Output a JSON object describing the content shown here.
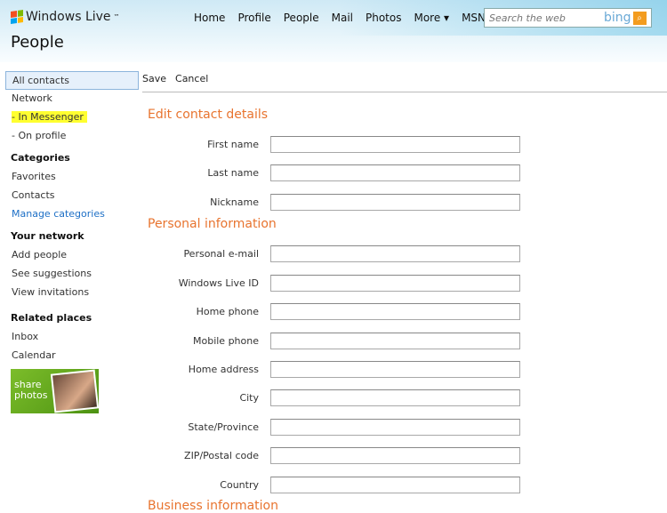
{
  "header": {
    "logo": "Windows Live",
    "logo_tm": "™",
    "title": "People",
    "nav": [
      "Home",
      "Profile",
      "People",
      "Mail",
      "Photos",
      "More ▾",
      "MSN ▾"
    ],
    "search_placeholder": "Search the web",
    "search_brand": "bing"
  },
  "sidebar": {
    "items1": [
      {
        "label": "All contacts",
        "selected": true
      },
      {
        "label": "Network"
      },
      {
        "label": "- In Messenger",
        "highlighted": true
      },
      {
        "label": "- On profile"
      }
    ],
    "categories": {
      "heading": "Categories",
      "items": [
        "Favorites",
        "Contacts"
      ],
      "manage": "Manage categories"
    },
    "network": {
      "heading": "Your network",
      "items": [
        "Add people",
        "See suggestions",
        "View invitations"
      ]
    },
    "related": {
      "heading": "Related places",
      "items": [
        "Inbox",
        "Calendar"
      ]
    },
    "promo": {
      "line1": "share",
      "line2": "photos"
    }
  },
  "toolbar": {
    "save": "Save",
    "cancel": "Cancel"
  },
  "form": {
    "sections": [
      "Edit contact details",
      "Personal information",
      "Business information"
    ],
    "contact_fields": [
      "First name",
      "Last name",
      "Nickname"
    ],
    "personal_fields": [
      "Personal e-mail",
      "Windows Live ID",
      "Home phone",
      "Mobile phone",
      "Home address",
      "City",
      "State/Province",
      "ZIP/Postal code",
      "Country"
    ]
  },
  "colors": {
    "section": "#e8742f",
    "link": "#1d6fc6",
    "highlight": "#ffff30"
  }
}
